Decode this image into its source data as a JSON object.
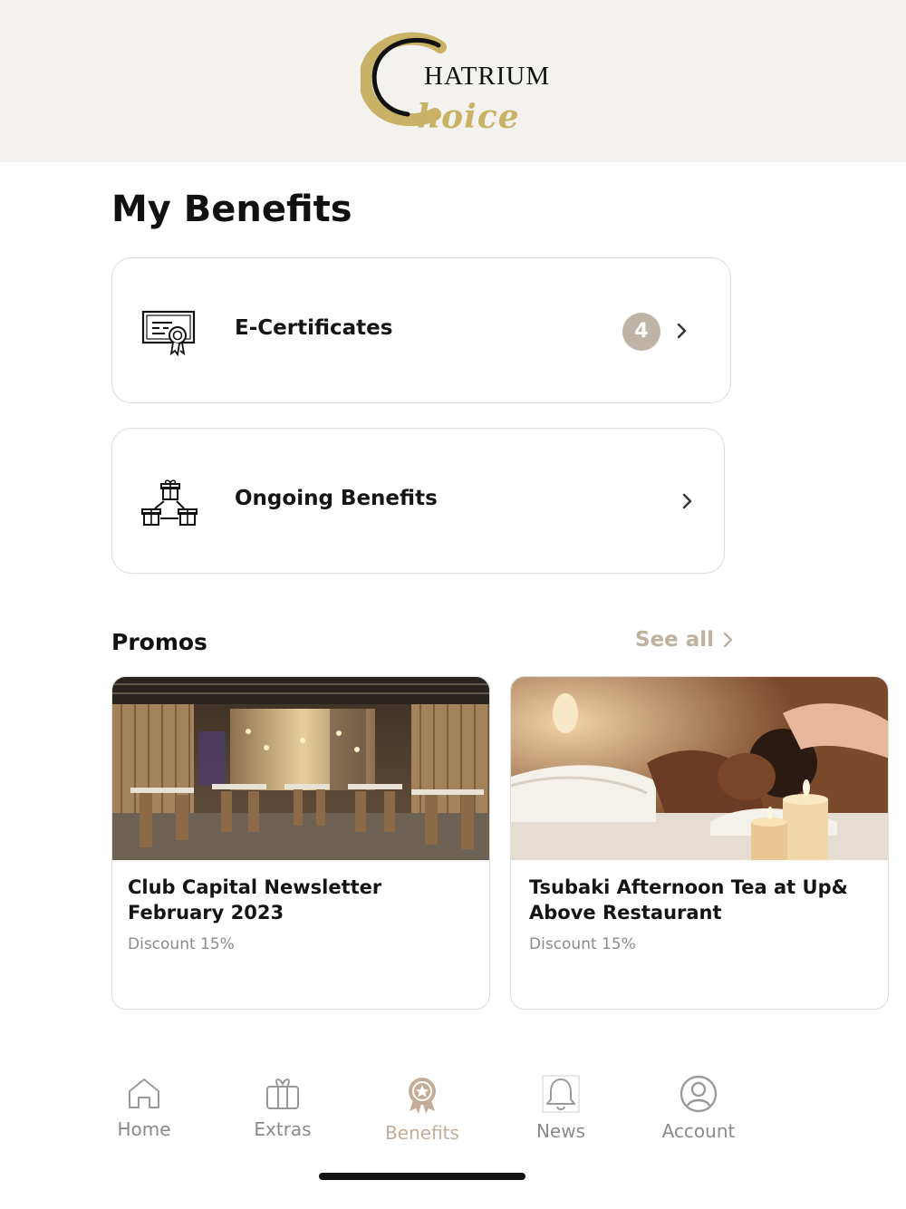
{
  "brand": {
    "logo_word": "HATRIUM",
    "logo_script": "hoice",
    "logo_alt": "Chatrium Choice"
  },
  "page": {
    "title": "My Benefits"
  },
  "cards": {
    "certificates": {
      "label": "E-Certificates",
      "count": "4",
      "icon": "certificate-icon"
    },
    "ongoing": {
      "label": "Ongoing Benefits",
      "icon": "gifts-network-icon"
    }
  },
  "promos": {
    "title": "Promos",
    "see_all": "See all",
    "items": [
      {
        "title": "Club Capital Newsletter February 2023",
        "discount": "Discount 15%",
        "image": "restaurant-interior-photo"
      },
      {
        "title": "Tsubaki Afternoon Tea at Up& Above Restaurant",
        "discount": "Discount 15%",
        "image": "spa-massage-photo"
      }
    ]
  },
  "tabbar": {
    "items": [
      {
        "label": "Home",
        "icon": "home-icon",
        "active": false
      },
      {
        "label": "Extras",
        "icon": "gift-icon",
        "active": false
      },
      {
        "label": "Benefits",
        "icon": "award-badge-icon",
        "active": true
      },
      {
        "label": "News",
        "icon": "bell-icon",
        "active": false
      },
      {
        "label": "Account",
        "icon": "user-circle-icon",
        "active": false
      }
    ]
  },
  "colors": {
    "accent": "#c3ad99",
    "badge": "#bfb3a5",
    "header_bg": "#f4f2ef",
    "logo_gold": "#c9b266"
  }
}
